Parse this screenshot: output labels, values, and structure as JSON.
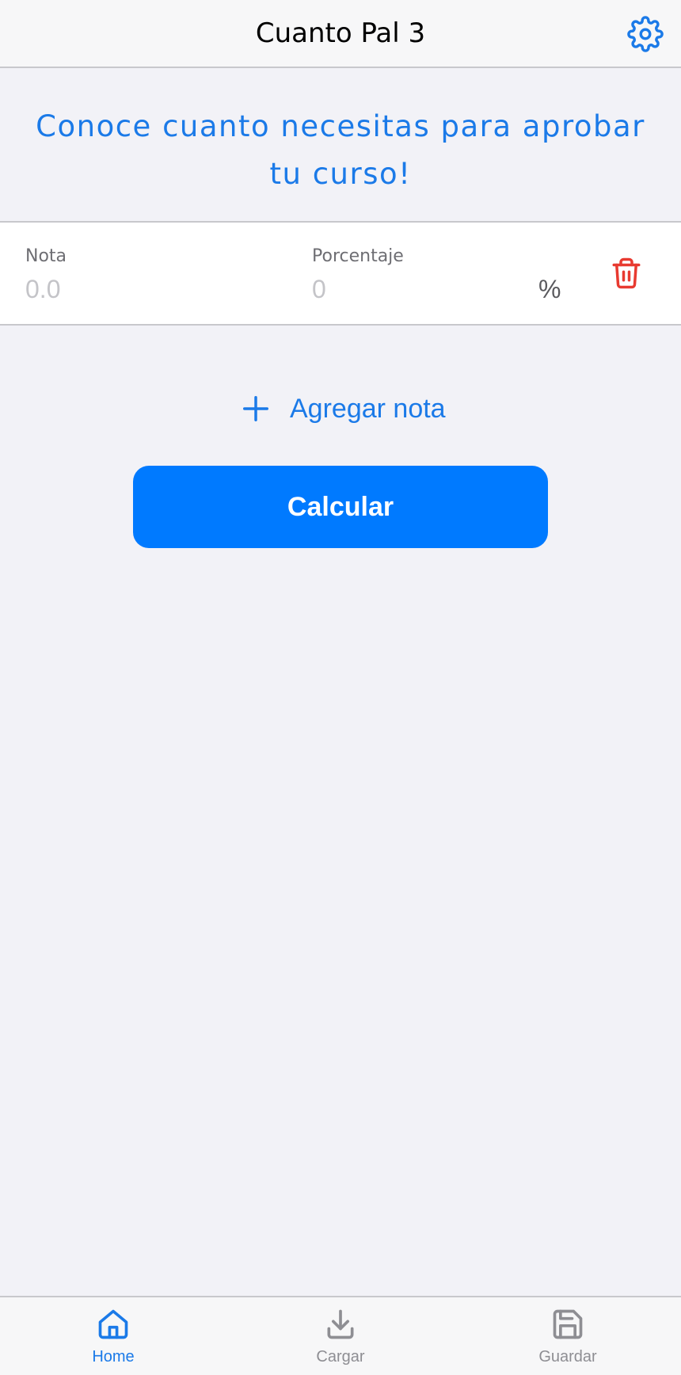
{
  "header": {
    "title": "Cuanto Pal 3",
    "settings_icon": "gear-icon"
  },
  "banner": {
    "text": "Conoce cuanto necesitas para aprobar tu curso!"
  },
  "grade_row": {
    "grade_label": "Nota",
    "grade_placeholder": "0.0",
    "grade_value": "",
    "percent_label": "Porcentaje",
    "percent_placeholder": "0",
    "percent_value": "",
    "percent_sign": "%",
    "delete_icon": "trash-icon"
  },
  "actions": {
    "add_grade_label": "Agregar nota",
    "calculate_label": "Calcular"
  },
  "tabbar": {
    "tabs": [
      {
        "label": "Home",
        "icon": "home-icon",
        "active": true
      },
      {
        "label": "Cargar",
        "icon": "download-icon",
        "active": false
      },
      {
        "label": "Guardar",
        "icon": "save-icon",
        "active": false
      }
    ]
  },
  "colors": {
    "accent": "#1b7ae8",
    "button": "#007aff",
    "danger": "#e83a30",
    "background": "#f2f2f7"
  }
}
